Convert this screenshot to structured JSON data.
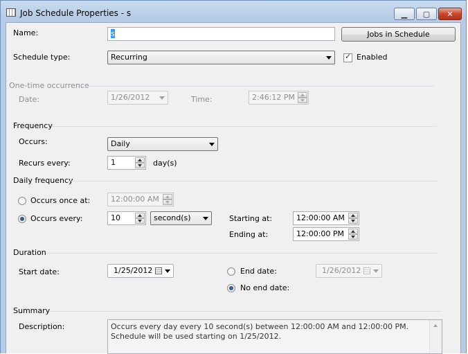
{
  "window": {
    "title": "Job Schedule Properties - s",
    "minimize": "▁",
    "maximize": "▢",
    "close": "✕"
  },
  "general": {
    "name_label": "Name:",
    "name_value": "s",
    "jobs_button": "Jobs in Schedule",
    "schedule_type_label": "Schedule type:",
    "schedule_type_value": "Recurring",
    "enabled_label": "Enabled",
    "enabled_checked": true
  },
  "one_time": {
    "section": "One-time occurrence",
    "date_label": "Date:",
    "date_value": "1/26/2012",
    "time_label": "Time:",
    "time_value": "2:46:12 PM"
  },
  "frequency": {
    "section": "Frequency",
    "occurs_label": "Occurs:",
    "occurs_value": "Daily",
    "recurs_label": "Recurs every:",
    "recurs_value": "1",
    "recurs_unit": "day(s)"
  },
  "daily_frequency": {
    "section": "Daily frequency",
    "once_label": "Occurs once at:",
    "once_value": "12:00:00 AM",
    "every_label": "Occurs every:",
    "every_value": "10",
    "every_unit": "second(s)",
    "starting_label": "Starting at:",
    "starting_value": "12:00:00 AM",
    "ending_label": "Ending at:",
    "ending_value": "12:00:00 PM"
  },
  "duration": {
    "section": "Duration",
    "start_label": "Start date:",
    "start_value": "1/25/2012",
    "end_label": "End date:",
    "end_value": "1/26/2012",
    "no_end_label": "No end date:"
  },
  "summary": {
    "section": "Summary",
    "description_label": "Description:",
    "description_value": "Occurs every day every 10 second(s) between 12:00:00 AM and 12:00:00 PM. Schedule will be used starting on 1/25/2012."
  }
}
